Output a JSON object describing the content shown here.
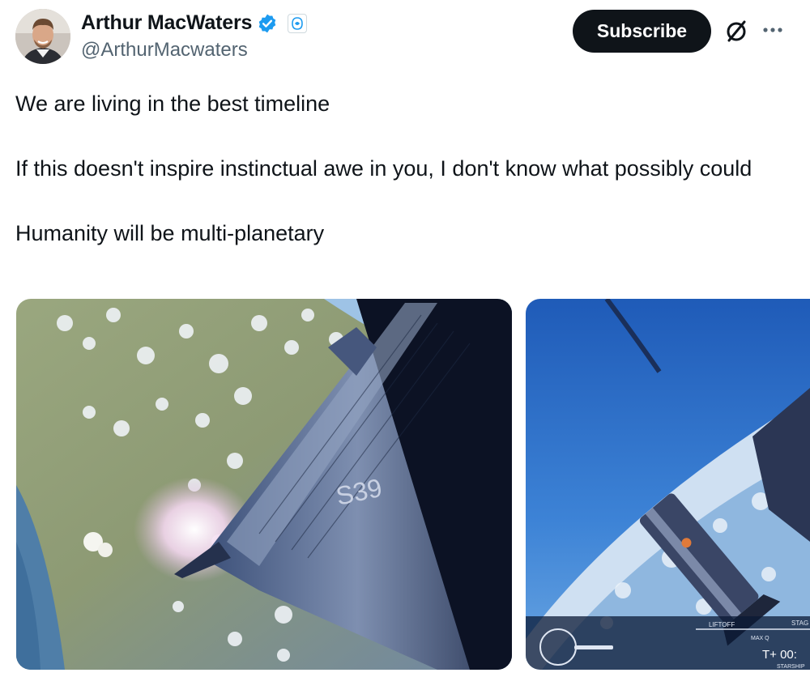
{
  "author": {
    "display_name": "Arthur MacWaters",
    "handle": "@ArthurMacwaters",
    "verified": true,
    "avatar_icon": "avatar-photo"
  },
  "actions": {
    "subscribe_label": "Subscribe",
    "grok_icon": "grok-icon",
    "more_icon": "more-icon"
  },
  "tweet": {
    "lines": [
      "We are living in the best timeline",
      "If this doesn't inspire instinctual awe in you, I don't know what possibly could",
      "Humanity will be multi-planetary"
    ]
  },
  "media": {
    "image1": {
      "ship_label": "S39"
    },
    "image2": {
      "hud_liftoff": "LIFTOFF",
      "hud_maxq": "MAX Q",
      "hud_stage": "STAG",
      "hud_timer": "T+ 00:",
      "hud_vehicle": "STARSHIP"
    }
  },
  "colors": {
    "accent": "#1d9bf0",
    "text": "#0f1419",
    "secondary": "#536471"
  }
}
